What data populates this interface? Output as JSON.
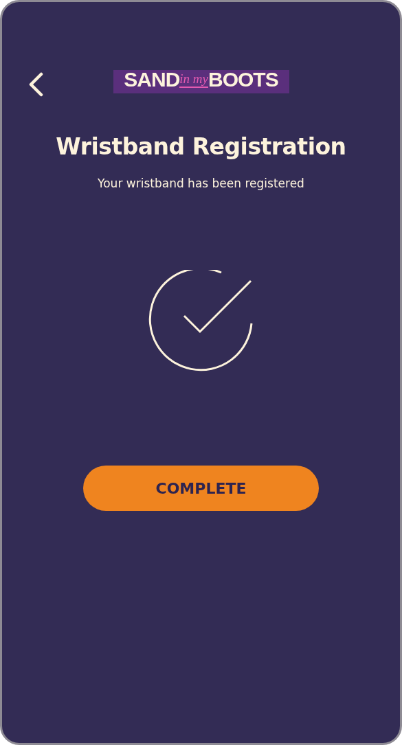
{
  "logo": {
    "words": [
      "SAND",
      "in my",
      "BOOTS"
    ]
  },
  "title": "Wristband Registration",
  "subtitle": "Your wristband has been registered",
  "button": {
    "label": "COMPLETE"
  }
}
